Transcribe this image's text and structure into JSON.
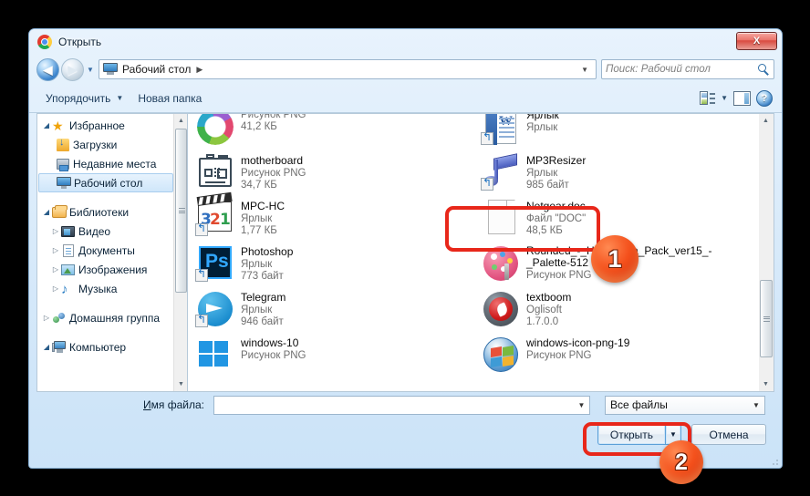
{
  "window": {
    "title": "Открыть",
    "app_icon": "chrome-icon",
    "close_label": "X"
  },
  "address": {
    "back_icon": "back-arrow-icon",
    "forward_icon": "forward-arrow-icon",
    "recent_icon": "chevron-down-icon",
    "location_icon": "desktop-icon",
    "location": "Рабочий стол",
    "separator": "▶",
    "dropdown_icon": "chevron-down-icon"
  },
  "search": {
    "placeholder": "Поиск: Рабочий стол",
    "icon": "search-icon"
  },
  "toolbar": {
    "organize": "Упорядочить",
    "organize_caret": "▼",
    "new_folder": "Новая папка",
    "view_icon": "view-mode-icon",
    "view_caret": "▼",
    "preview_pane_icon": "preview-pane-icon",
    "help_icon": "help-icon",
    "help_label": "?"
  },
  "sidebar": {
    "scroll_up_icon": "scroll-up-arrow-icon",
    "scroll_down_icon": "scroll-down-arrow-icon",
    "items": [
      {
        "label": "Избранное",
        "icon": "star-icon",
        "twisty": "◢",
        "level": 0,
        "selected": false
      },
      {
        "label": "Загрузки",
        "icon": "downloads-icon",
        "twisty": "",
        "level": 1,
        "selected": false
      },
      {
        "label": "Недавние места",
        "icon": "recent-icon",
        "twisty": "",
        "level": 1,
        "selected": false
      },
      {
        "label": "Рабочий стол",
        "icon": "desktop-icon",
        "twisty": "",
        "level": 1,
        "selected": true
      },
      {
        "label": "Библиотеки",
        "icon": "library-icon",
        "twisty": "◢",
        "level": 0,
        "selected": false
      },
      {
        "label": "Видео",
        "icon": "video-icon",
        "twisty": "▷",
        "level": 1,
        "selected": false
      },
      {
        "label": "Документы",
        "icon": "documents-icon",
        "twisty": "▷",
        "level": 1,
        "selected": false
      },
      {
        "label": "Изображения",
        "icon": "pictures-icon",
        "twisty": "▷",
        "level": 1,
        "selected": false
      },
      {
        "label": "Музыка",
        "icon": "music-icon",
        "twisty": "▷",
        "level": 1,
        "selected": false
      },
      {
        "label": "Домашняя группа",
        "icon": "homegroup-icon",
        "twisty": "▷",
        "level": 0,
        "selected": false
      },
      {
        "label": "Компьютер",
        "icon": "computer-icon",
        "twisty": "◢",
        "level": 0,
        "selected": false
      }
    ]
  },
  "files": {
    "left_column": [
      {
        "name": "",
        "type": "Рисунок PNG",
        "size": "41,2 КБ",
        "icon": "png-image-icon",
        "shortcut": false
      },
      {
        "name": "motherboard",
        "type": "Рисунок PNG",
        "size": "34,7 КБ",
        "icon": "motherboard-icon",
        "shortcut": false
      },
      {
        "name": "MPC-HC",
        "type": "Ярлык",
        "size": "1,77 КБ",
        "icon": "mpc-hc-icon",
        "shortcut": true
      },
      {
        "name": "Photoshop",
        "type": "Ярлык",
        "size": "773 байт",
        "icon": "photoshop-icon",
        "shortcut": true
      },
      {
        "name": "Telegram",
        "type": "Ярлык",
        "size": "946 байт",
        "icon": "telegram-icon",
        "shortcut": true
      },
      {
        "name": "windows-10",
        "type": "Рисунок PNG",
        "size": "",
        "icon": "windows-10-icon",
        "shortcut": false
      }
    ],
    "right_column": [
      {
        "name": "",
        "type": "Ярлык",
        "size": "Ярлык",
        "icon": "word-document-icon",
        "shortcut": true,
        "first_line": "Ярлык"
      },
      {
        "name": "MP3Resizer",
        "type": "Ярлык",
        "size": "985 байт",
        "icon": "mp3resizer-icon",
        "shortcut": true
      },
      {
        "name": "Netgear.doc",
        "type": "Файл \"DOC\"",
        "size": "48,5 КБ",
        "icon": "doc-file-icon",
        "shortcut": false,
        "highlighted": true
      },
      {
        "name": "Rounded_-_High_Ultra_Pack_ver15_-_Palette-512",
        "type": "Рисунок PNG",
        "size": "",
        "icon": "palette-icon",
        "shortcut": false
      },
      {
        "name": "textboom",
        "type": "Oglisoft",
        "size": "1.7.0.0",
        "icon": "textboom-icon",
        "shortcut": false
      },
      {
        "name": "windows-icon-png-19",
        "type": "Рисунок PNG",
        "size": "",
        "icon": "windows-7-icon",
        "shortcut": false
      }
    ]
  },
  "form": {
    "filename_label_prefix": "И",
    "filename_label_rest": "мя файла:",
    "filename_value": "",
    "filename_dropdown_icon": "chevron-down-icon",
    "filetype_value": "Все файлы",
    "filetype_dropdown_icon": "chevron-down-icon",
    "open_button": "Открыть",
    "open_split_icon": "chevron-down-icon",
    "cancel_button": "Отмена"
  },
  "annotations": {
    "badge_one": "1",
    "badge_two": "2",
    "accent_color": "#e8271a",
    "badge_color": "#f4501c"
  }
}
